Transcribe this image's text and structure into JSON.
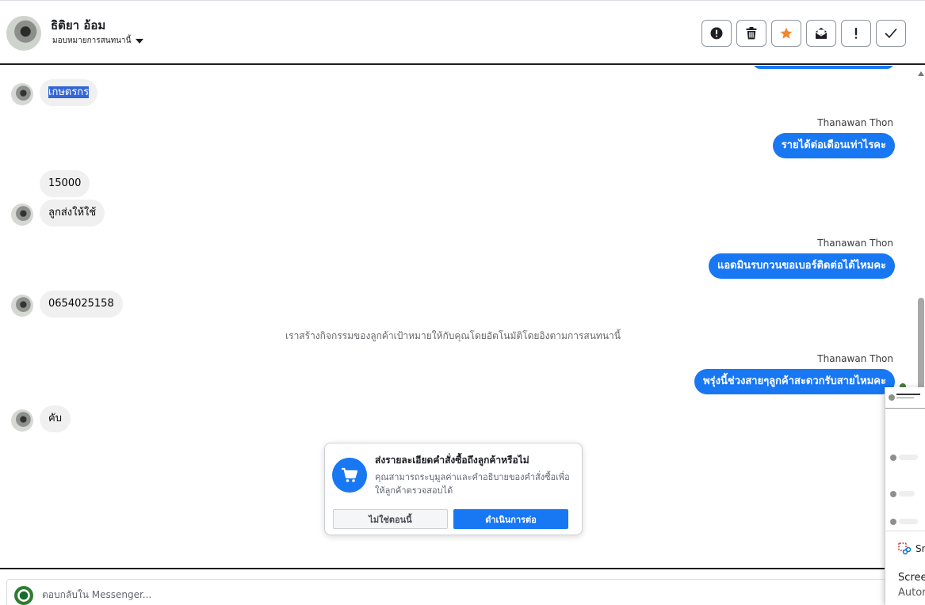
{
  "header": {
    "contact_name": "ธิติยา อ้อม",
    "assign_label": "มอบหมายการสนทนานี้",
    "toolbar_icons": [
      "alert-circle-icon",
      "trash-icon",
      "star-icon",
      "mark-unread-icon",
      "exclamation-icon",
      "check-icon"
    ],
    "star_color": "#f0862f"
  },
  "messages": [
    {
      "direction": "in",
      "text": "เกษตรกร",
      "selected": true
    },
    {
      "direction": "out",
      "sender": "Thanawan Thon",
      "text": "รายได้ต่อเดือนเท่าไรคะ"
    },
    {
      "direction": "in",
      "text": "15000"
    },
    {
      "direction": "in",
      "text": "ลูกส่งให้ใช้"
    },
    {
      "direction": "out",
      "sender": "Thanawan Thon",
      "text": "แอดมินรบกวนขอเบอร์ติดต่อได้ไหมคะ"
    },
    {
      "direction": "in",
      "text": "0654025158"
    },
    {
      "direction": "system",
      "text": "เราสร้างกิจกรรมของลูกค้าเป้าหมายให้กับคุณโดยอัตโนมัติโดยอิงตามการสนทนานี้"
    },
    {
      "direction": "out",
      "sender": "Thanawan Thon",
      "text": "พรุ่งนี้ช่วงสายๆลูกค้าสะดวกรับสายไหมคะ"
    },
    {
      "direction": "in",
      "text": "คับ"
    }
  ],
  "order_prompt": {
    "title": "ส่งรายละเอียดคำสั่งซื้อถึงลูกค้าหรือไม่",
    "body": "คุณสามารถระบุมูลค่าและคำอธิบายของคำสั่งซื้อเพื่อให้ลูกค้าตรวจสอบได้",
    "decline_label": "ไม่ใช่ตอนนี้",
    "continue_label": "ดำเนินการต่อ"
  },
  "reply": {
    "placeholder": "ตอบกลับใน Messenger..."
  },
  "snip_overlay": {
    "tool_label": "Sn",
    "title": "Screen",
    "subtitle": "Autom"
  },
  "colors": {
    "accent": "#1877f2",
    "incoming_bubble": "#f0f0f0",
    "selection": "#3367d6"
  }
}
